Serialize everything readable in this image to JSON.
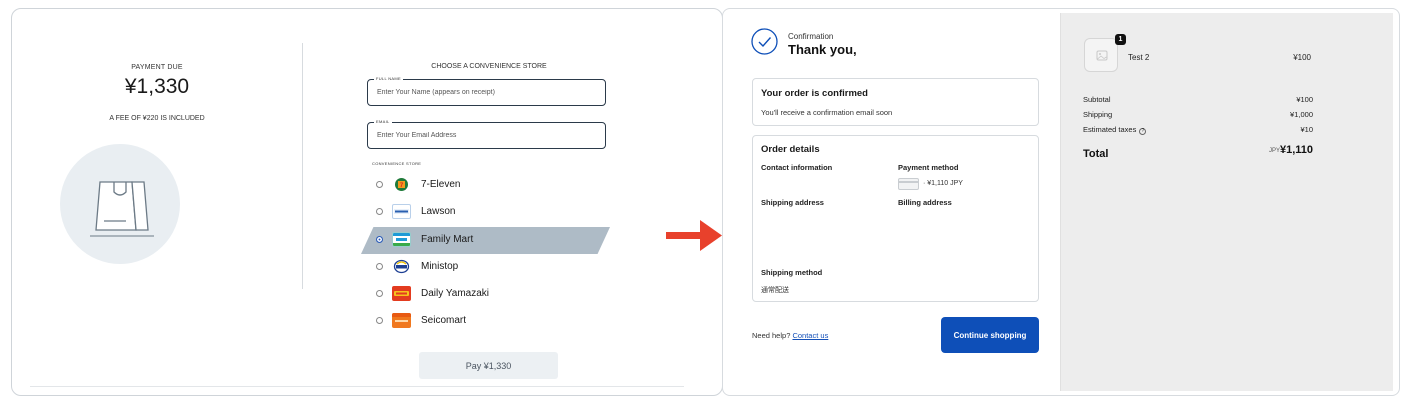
{
  "payment": {
    "due_label": "PAYMENT DUE",
    "due_amount": "¥1,330",
    "fee_note": "A FEE OF ¥220 IS INCLUDED",
    "choose_title": "CHOOSE A CONVENIENCE STORE",
    "full_name": {
      "legend": "FULL NAME",
      "placeholder": "Enter Your Name (appears on receipt)"
    },
    "email": {
      "legend": "EMAIL",
      "placeholder": "Enter Your Email Address"
    },
    "store_label": "CONVENIENCE STORE",
    "stores": [
      {
        "name": "7-Eleven",
        "logo": "7-eleven-logo",
        "color": "#1f7a3a",
        "selected": false
      },
      {
        "name": "Lawson",
        "logo": "lawson-logo",
        "color": "#ffffff",
        "selected": false
      },
      {
        "name": "Family Mart",
        "logo": "familymart-logo",
        "color": "#ffffff",
        "selected": true
      },
      {
        "name": "Ministop",
        "logo": "ministop-logo",
        "color": "#ffffff",
        "selected": false
      },
      {
        "name": "Daily Yamazaki",
        "logo": "daily-yamazaki-logo",
        "color": "#e33b1f",
        "selected": false
      },
      {
        "name": "Seicomart",
        "logo": "seicomart-logo",
        "color": "#f0781e",
        "selected": false
      }
    ],
    "pay_button": "Pay ¥1,330"
  },
  "confirmation": {
    "small_label": "Confirmation",
    "thanks": "Thank you,",
    "confirmed_title": "Your order is confirmed",
    "confirmed_text": "You'll receive a confirmation email soon",
    "details_title": "Order details",
    "contact_label": "Contact information",
    "payment_label": "Payment method",
    "payment_value": "· ¥1,110 JPY",
    "shipping_label": "Shipping address",
    "billing_label": "Billing address",
    "shipping_method_label": "Shipping method",
    "shipping_method_value": "通常配送",
    "help_text": "Need help?",
    "help_link": "Contact us",
    "continue_button": "Continue shopping"
  },
  "summary": {
    "item_qty": "1",
    "item_name": "Test 2",
    "item_price": "¥100",
    "subtotal_label": "Subtotal",
    "subtotal_value": "¥100",
    "shipping_label": "Shipping",
    "shipping_value": "¥1,000",
    "taxes_label": "Estimated taxes",
    "taxes_value": "¥10",
    "total_label": "Total",
    "total_currency": "JPY",
    "total_value": "¥1,110"
  },
  "colors": {
    "accent": "#0e4fb8",
    "arrow": "#e8412c",
    "selected_row": "#aebbc6"
  }
}
